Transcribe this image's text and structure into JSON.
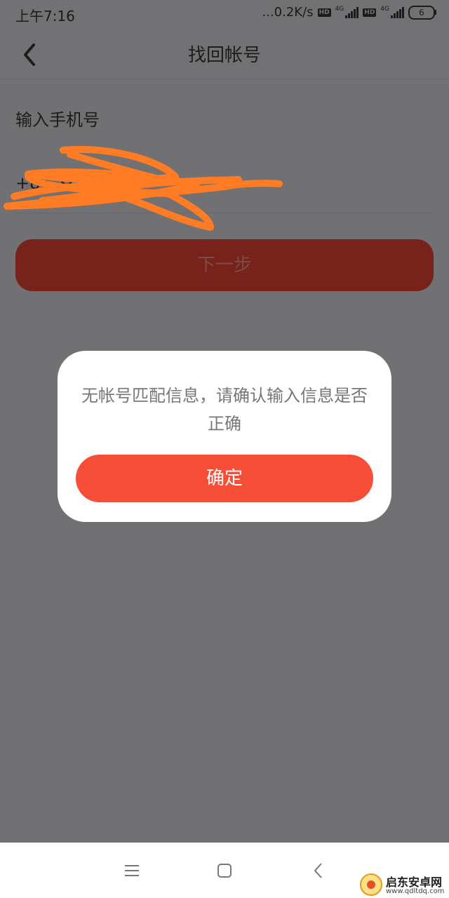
{
  "status_bar": {
    "time": "上午7:16",
    "network_speed": "...0.2K/s",
    "hd_label": "HD",
    "network_type": "4G",
    "battery_level": "6"
  },
  "header": {
    "title": "找回帐号"
  },
  "form": {
    "phone_label": "输入手机号",
    "country_code": "+86",
    "next_button": "下一步"
  },
  "dialog": {
    "message": "无帐号匹配信息，请确认输入信息是否正确",
    "confirm_button": "确定"
  },
  "watermark": {
    "name": "启东安卓网",
    "url": "www.qdltdq.com"
  },
  "colors": {
    "accent": "#f64e37",
    "scribble": "#ff7b24"
  }
}
